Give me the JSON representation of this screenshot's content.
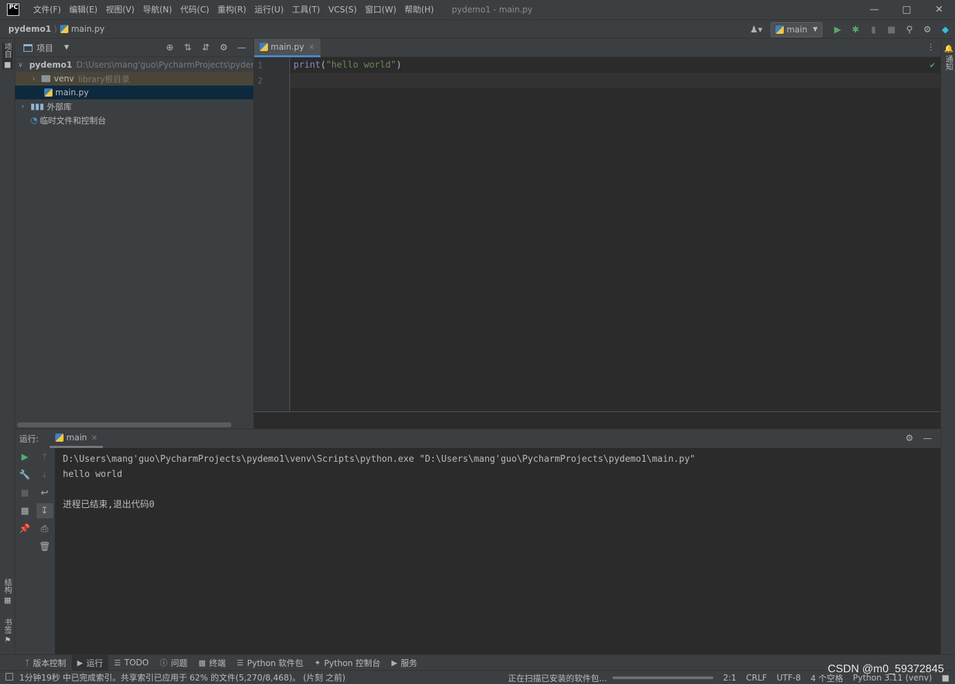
{
  "titlebar": {
    "logo": "PC",
    "menus": [
      "文件(F)",
      "编辑(E)",
      "视图(V)",
      "导航(N)",
      "代码(C)",
      "重构(R)",
      "运行(U)",
      "工具(T)",
      "VCS(S)",
      "窗口(W)",
      "帮助(H)"
    ],
    "window_title": "pydemo1 - main.py"
  },
  "navbar": {
    "project": "pydemo1",
    "file": "main.py",
    "run_config": "main"
  },
  "left_stripe": {
    "project_tab": "项目",
    "structure_tab": "结构",
    "bookmarks_tab": "书签"
  },
  "right_stripe": {
    "notifications_tab": "通知"
  },
  "project_panel": {
    "title": "项目",
    "tree": [
      {
        "label": "pydemo1",
        "hint": "D:\\Users\\mang'guo\\PycharmProjects\\pydemo1"
      },
      {
        "label": "venv",
        "hint": "library根目录"
      },
      {
        "label": "main.py",
        "hint": ""
      },
      {
        "label": "外部库",
        "hint": ""
      },
      {
        "label": "临时文件和控制台",
        "hint": ""
      }
    ]
  },
  "editor": {
    "tab_label": "main.py",
    "line_numbers": [
      "1",
      "2"
    ],
    "code": {
      "fn": "print",
      "open": "(",
      "str": "\"hello world\"",
      "close": ")"
    }
  },
  "run_panel": {
    "label": "运行:",
    "tab_label": "main",
    "output": [
      "D:\\Users\\mang'guo\\PycharmProjects\\pydemo1\\venv\\Scripts\\python.exe \"D:\\Users\\mang'guo\\PycharmProjects\\pydemo1\\main.py\"",
      "hello world",
      "",
      "进程已结束,退出代码0"
    ]
  },
  "toolwindows": [
    "版本控制",
    "运行",
    "TODO",
    "问题",
    "终端",
    "Python 软件包",
    "Python 控制台",
    "服务"
  ],
  "statusbar": {
    "message": "1分钟19秒 中已完成索引。共享索引已应用于 62% 的文件(5,270/8,468)。 (片刻 之前)",
    "scanning": "正在扫描已安装的软件包...",
    "caret": "2:1",
    "line_sep": "CRLF",
    "encoding": "UTF-8",
    "indent": "4 个空格",
    "interpreter": "Python 3.11 (venv)"
  },
  "watermark": "CSDN @m0_59372845"
}
